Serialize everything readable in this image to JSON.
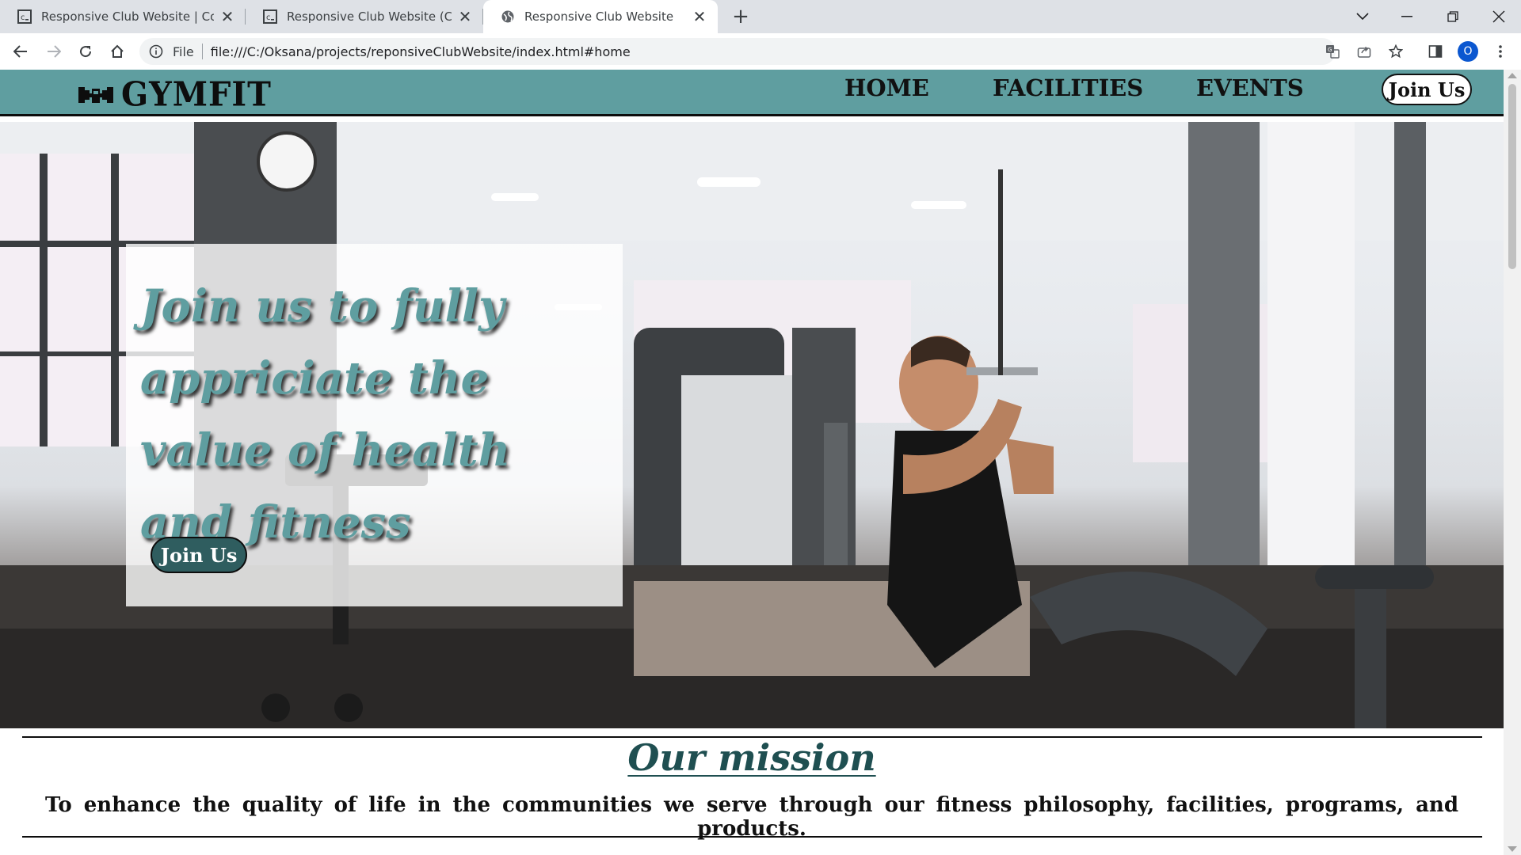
{
  "browser": {
    "tabs": [
      {
        "title": "Responsive Club Website | Codec",
        "favicon": "codecademy-icon"
      },
      {
        "title": "Responsive Club Website (CSS) -",
        "favicon": "codecademy-icon"
      },
      {
        "title": "Responsive Club Website",
        "favicon": "globe-icon"
      }
    ],
    "address_scheme": "File",
    "url": "file:///C:/Oksana/projects/reponsiveClubWebsite/index.html#home",
    "profile_initial": "O"
  },
  "site": {
    "brand": "GYMFIT",
    "nav": {
      "home": "HOME",
      "facilities": "FACILITIES",
      "events": "EVENTS"
    },
    "join_top": "Join Us",
    "hero": {
      "title": "Join us to fully appriciate the value of health and fitness",
      "button": "Join Us"
    },
    "mission": {
      "title": "Our mission",
      "text": "To enhance the quality of life in the communities we serve through our fitness philosophy, facilities, programs, and products."
    },
    "colors": {
      "accent": "#5f9ea0",
      "dark_teal": "#2f5d5f",
      "mission_title": "#1f4f51"
    }
  }
}
